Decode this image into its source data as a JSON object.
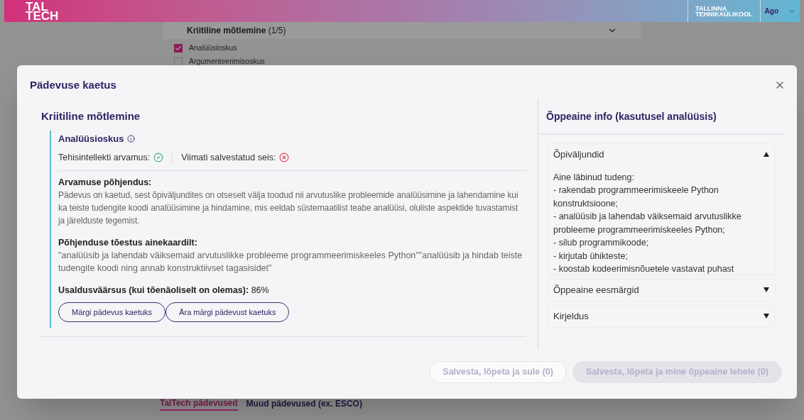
{
  "header": {
    "logo_lines": [
      "TAL",
      "TECH"
    ],
    "university_lines": [
      "TALLINNA",
      "TEHNIKAÜLIKOOL"
    ],
    "user": "Ago"
  },
  "background": {
    "section": {
      "title": "Kriitiline mõtlemine",
      "count": "(1/5)",
      "expanded": true
    },
    "skills": [
      {
        "label": "Analüüsioskus",
        "checked": true
      },
      {
        "label": "Argumenteerimisoskus",
        "checked": false
      }
    ],
    "tabs": [
      {
        "label": "TalTech pädevused",
        "selected": true
      },
      {
        "label": "Muud pädevused (ex. ESCO)",
        "selected": false
      }
    ]
  },
  "modal": {
    "title": "Pädevuse kaetus",
    "left": {
      "group_title": "Kriitiline mõtlemine",
      "skill": {
        "name": "Analüüsioskus",
        "ai_label": "Tehisintellekti arvamus:",
        "ai_covered": true,
        "saved_label": "Viimati salvestatud seis:",
        "saved_covered": false
      },
      "reasoning": {
        "heading": "Arvamuse põhjendus:",
        "text": "Pädevus on kaetud, sest õpiväljundites on otseselt välja toodud nii arvutuslike probleemide analüüsimine ja lahendamine kui ka teiste tudengite koodi analüüsimine ja hindamine, mis eeldab süstemaatilist teabe analüüsi, oluliste aspektide tuvastamist ja järelduste tegemist."
      },
      "evidence": {
        "heading": "Põhjenduse tõestus ainekaardilt:",
        "text": "\"analüüsib ja lahendab väiksemaid arvutuslikke probleeme programmeerimiskeeles Python\"\"analüüsib ja hindab teiste tudengite koodi ning annab konstruktiivset tagasisidet\""
      },
      "confidence": {
        "label": "Usaldusväärsus (kui tõenäoliselt on olemas):",
        "value": "86%"
      },
      "buttons": [
        "Märgi pädevus kaetuks",
        "Ära märgi pädevust kaetuks"
      ]
    },
    "right": {
      "title": "Õppeaine info (kasutusel analüüsis)",
      "accordions": [
        {
          "title": "Õpiväljundid",
          "expanded": true,
          "lines": [
            "Aine läbinud tudeng:",
            "- rakendab programmeerimiskeele Python konstruktsioone;",
            "- analüüsib ja lahendab väiksemaid arvutuslikke probleeme programmeerimiskeeles Python;",
            "- silub programmikoode;",
            "- kirjutab ühikteste;",
            "- koostab kodeerimisnõuetele vastavat puhast"
          ]
        },
        {
          "title": "Õppeaine eesmärgid",
          "expanded": false
        },
        {
          "title": "Kirjeldus",
          "expanded": false
        }
      ]
    },
    "footer_buttons": [
      {
        "label": "Salvesta, lõpeta ja sule (0)",
        "kind": "outline",
        "disabled": true
      },
      {
        "label": "Salvesta, lõpeta ja mine õppeaine lehele (0)",
        "kind": "filled",
        "disabled": true
      }
    ]
  }
}
